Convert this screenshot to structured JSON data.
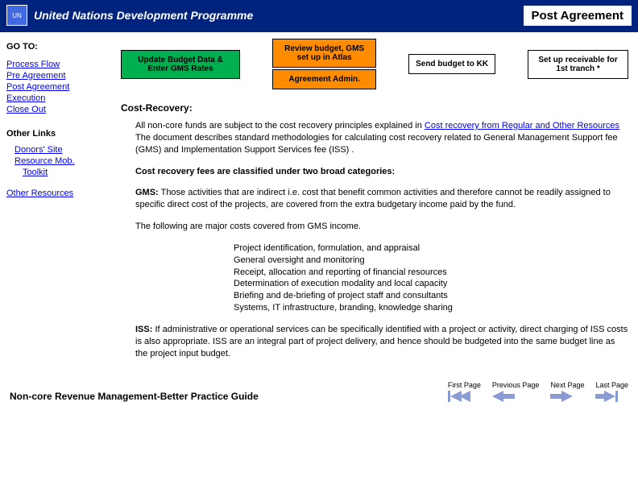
{
  "header": {
    "org": "United Nations Development Programme",
    "page_title": "Post Agreement"
  },
  "sidebar": {
    "goto_label": "GO TO:",
    "links": [
      "Process Flow",
      "Pre Agreement",
      "Post Agreement",
      "Execution",
      "Close Out"
    ],
    "other_links_label": "Other Links",
    "donors": [
      "Donors' Site",
      "Resource Mob.",
      "Toolkit"
    ],
    "other_resources": "Other Resources"
  },
  "flow": [
    "Update Budget Data & Enter GMS Rates",
    "Review budget, GMS set up in Atlas",
    "Agreement Admin.",
    "Send budget to KK",
    "Set up receivable for 1st tranch *"
  ],
  "section": "Cost-Recovery:",
  "p1a": "All non-core funds are subject to the cost recovery principles explained in ",
  "p1link": "Cost recovery from Regular and Other Resources",
  "p1b": " The document describes standard methodologies for calculating cost recovery related to General Management Support fee (GMS) and Implementation Support Services fee (ISS) .",
  "p2": "Cost recovery fees are classified under two broad categories:",
  "gms_label": "GMS:",
  "gms_text": "Those activities that are indirect i.e. cost that benefit common activities and therefore cannot be readily assigned to specific direct cost of the projects, are covered from the extra budgetary income paid by the fund.",
  "gms_intro": "The following are major costs covered from GMS income.",
  "gms_items": [
    "Project identification, formulation, and appraisal",
    "General oversight and monitoring",
    "Receipt, allocation and reporting of financial resources",
    "Determination of execution modality and local capacity",
    "Briefing and de-briefing of project staff and consultants",
    "Systems, IT infrastructure, branding, knowledge sharing"
  ],
  "iss_label": "ISS:",
  "iss_text": "If administrative or operational services can be specifically identified with a project or activity, direct charging of ISS costs is also appropriate. ISS are an integral part of project delivery, and hence should be budgeted into the same budget line as the project input budget.",
  "footer_title": "Non-core Revenue Management-Better Practice Guide",
  "nav": {
    "first": "First Page",
    "prev": "Previous Page",
    "next": "Next Page",
    "last": "Last Page"
  }
}
